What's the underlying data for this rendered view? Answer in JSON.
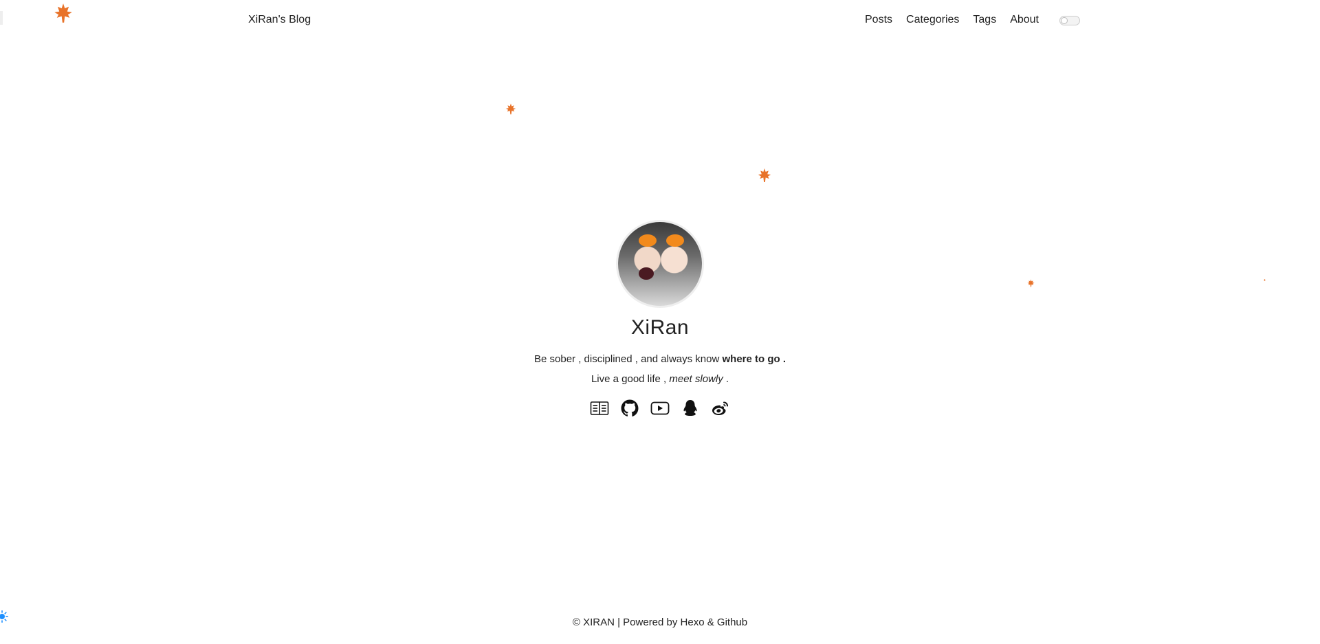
{
  "header": {
    "site_title": "XiRan's Blog",
    "nav": [
      "Posts",
      "Categories",
      "Tags",
      "About"
    ]
  },
  "profile": {
    "name": "XiRan",
    "bio_line1_prefix": "Be sober , disciplined , and always know ",
    "bio_line1_bold": "where to go .",
    "bio_line2_prefix": "Live a good life , ",
    "bio_line2_italic": "meet slowly",
    "bio_line2_suffix": " .",
    "social_icons": [
      "book-icon",
      "github-icon",
      "youtube-icon",
      "qq-icon",
      "weibo-icon"
    ]
  },
  "footer": {
    "copyright": "© XIRAN | Powered by Hexo & Github"
  },
  "colors": {
    "leaf": "#e8732a",
    "sun": "#1e90ff"
  }
}
